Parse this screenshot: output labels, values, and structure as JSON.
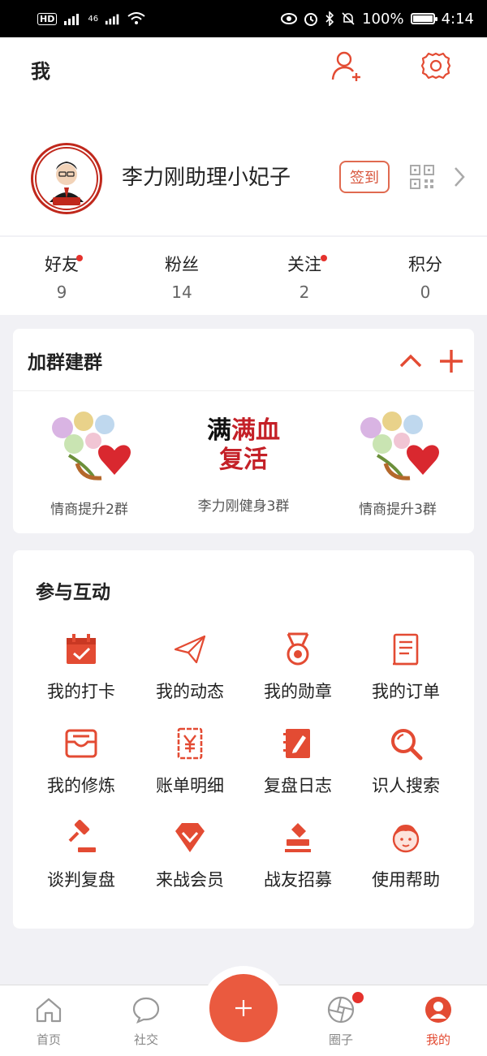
{
  "status_bar": {
    "hd": "HD",
    "network": "46",
    "battery": "100%",
    "battery_level": 1.0,
    "time": "4:14"
  },
  "header": {
    "title": "我"
  },
  "profile": {
    "name": "李力刚助理小妃子",
    "checkin_label": "签到"
  },
  "stats": [
    {
      "label": "好友",
      "value": "9",
      "dot": true
    },
    {
      "label": "粉丝",
      "value": "14",
      "dot": false
    },
    {
      "label": "关注",
      "value": "2",
      "dot": true
    },
    {
      "label": "积分",
      "value": "0",
      "dot": false
    }
  ],
  "groups": {
    "title": "加群建群",
    "items": [
      {
        "name": "情商提升2群",
        "icon": "flower-heart-image"
      },
      {
        "name": "李力刚健身3群",
        "icon": "calligraphy-image",
        "image_text": "满血复活"
      },
      {
        "name": "情商提升3群",
        "icon": "flower-heart-image"
      }
    ]
  },
  "interact": {
    "title": "参与互动",
    "items": [
      {
        "label": "我的打卡",
        "icon": "calendar-check-icon"
      },
      {
        "label": "我的动态",
        "icon": "paper-plane-icon"
      },
      {
        "label": "我的勋章",
        "icon": "medal-icon"
      },
      {
        "label": "我的订单",
        "icon": "receipt-icon"
      },
      {
        "label": "我的修炼",
        "icon": "inbox-icon"
      },
      {
        "label": "账单明细",
        "icon": "bill-yen-icon"
      },
      {
        "label": "复盘日志",
        "icon": "notebook-pen-icon"
      },
      {
        "label": "识人搜索",
        "icon": "search-icon"
      },
      {
        "label": "谈判复盘",
        "icon": "gavel-icon"
      },
      {
        "label": "来战会员",
        "icon": "diamond-icon"
      },
      {
        "label": "战友招募",
        "icon": "stamp-icon"
      },
      {
        "label": "使用帮助",
        "icon": "person-help-icon"
      }
    ]
  },
  "nav": {
    "items": [
      {
        "label": "首页",
        "icon": "home-icon"
      },
      {
        "label": "社交",
        "icon": "chat-icon"
      },
      {
        "label": "圈子",
        "icon": "aperture-icon"
      },
      {
        "label": "我的",
        "icon": "user-icon"
      }
    ],
    "active": "我的"
  },
  "colors": {
    "accent": "#e34b33",
    "background": "#f1f1f5"
  }
}
